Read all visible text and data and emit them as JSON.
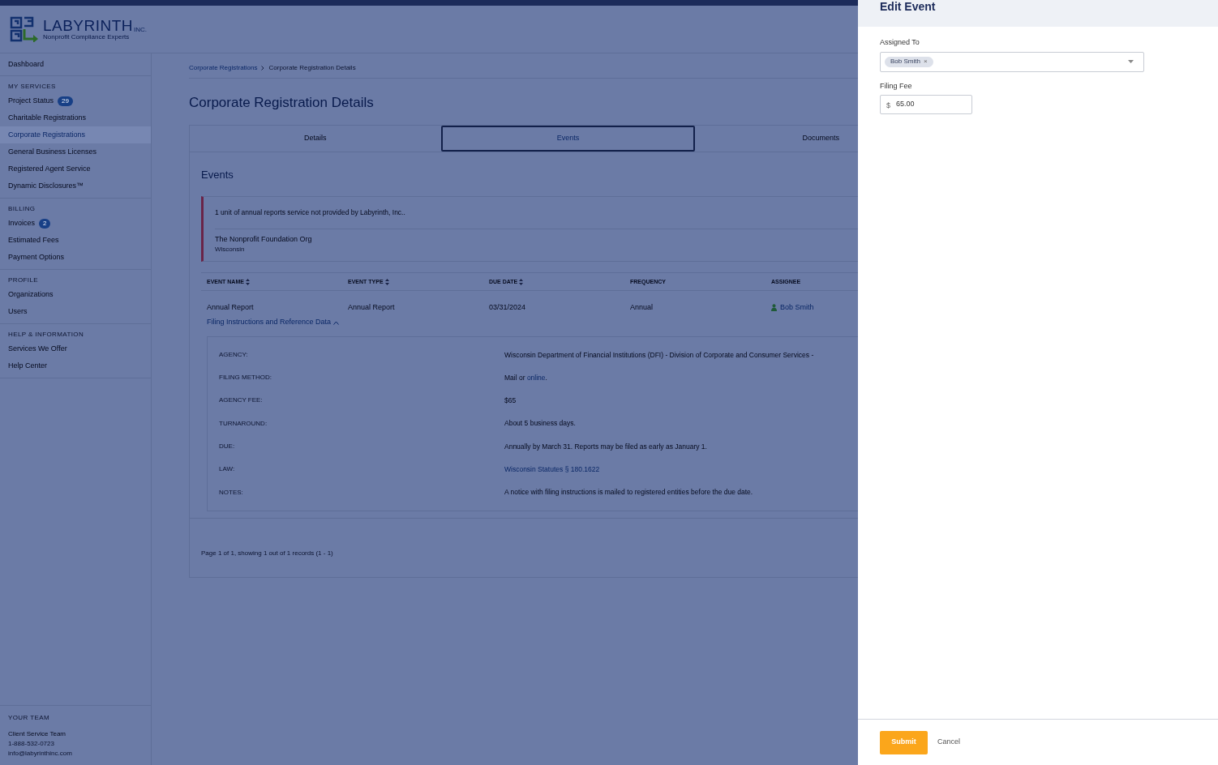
{
  "brand": {
    "name": "LABYRINTH",
    "suffix": "INC.",
    "tagline": "Nonprofit Compliance Experts"
  },
  "sidebar": {
    "top_item": {
      "label": "Dashboard",
      "selected": false
    },
    "sections": [
      {
        "heading": "MY SERVICES",
        "items": [
          {
            "label": "Project Status",
            "badge": "29",
            "selected": false
          },
          {
            "label": "Charitable Registrations",
            "selected": false
          },
          {
            "label": "Corporate Registrations",
            "selected": true
          },
          {
            "label": "General Business Licenses",
            "selected": false
          },
          {
            "label": "Registered Agent Service",
            "selected": false
          },
          {
            "label": "Dynamic Disclosures™",
            "selected": false
          }
        ]
      },
      {
        "heading": "BILLING",
        "items": [
          {
            "label": "Invoices",
            "badge": "2",
            "selected": false
          },
          {
            "label": "Estimated Fees",
            "selected": false
          },
          {
            "label": "Payment Options",
            "selected": false
          }
        ]
      },
      {
        "heading": "PROFILE",
        "items": [
          {
            "label": "Organizations",
            "selected": false
          },
          {
            "label": "Users",
            "selected": false
          }
        ]
      },
      {
        "heading": "HELP & INFORMATION",
        "items": [
          {
            "label": "Services We Offer",
            "selected": false
          },
          {
            "label": "Help Center",
            "selected": false
          }
        ]
      }
    ],
    "team": {
      "heading": "YOUR TEAM",
      "name": "Client Service Team",
      "phone": "1-888-532-0723",
      "email": "info@labyrinthinc.com"
    }
  },
  "breadcrumb": [
    "Corporate Registrations",
    "Corporate Registration Details"
  ],
  "page_title": "Corporate Registration Details",
  "tabs": [
    {
      "label": "Details",
      "selected": false
    },
    {
      "label": "Events",
      "selected": true
    },
    {
      "label": "Documents",
      "selected": false
    }
  ],
  "section_title": "Events",
  "notice": {
    "message": "1 unit of annual reports service not provided by Labyrinth, Inc..",
    "org": "The Nonprofit Foundation Org",
    "state": "Wisconsin"
  },
  "table": {
    "columns": [
      {
        "label": "EVENT NAME",
        "sortable": true
      },
      {
        "label": "EVENT TYPE",
        "sortable": true
      },
      {
        "label": "DUE DATE",
        "sortable": true
      },
      {
        "label": "FREQUENCY",
        "sortable": false
      },
      {
        "label": "ASSIGNEE",
        "sortable": false
      }
    ],
    "rows": [
      {
        "cells": [
          "Annual Report",
          "Annual Report",
          "03/31/2024",
          "Annual"
        ],
        "assignee": "Bob Smith"
      }
    ]
  },
  "details_toggle": {
    "label": "Filing Instructions and Reference Data",
    "expanded": true
  },
  "details": [
    {
      "label": "AGENCY:",
      "value": "Wisconsin Department of Financial Institutions (DFI) - Division of Corporate and Consumer Services -"
    },
    {
      "label": "FILING METHOD:",
      "value": "Mail or ",
      "link": "online",
      "after": "."
    },
    {
      "label": "AGENCY FEE:",
      "value": "$65"
    },
    {
      "label": "TURNAROUND:",
      "value": "About 5 business days."
    },
    {
      "label": "DUE:",
      "value": "Annually by March 31. Reports may be filed as early as January 1."
    },
    {
      "label": "LAW:",
      "link": "Wisconsin Statutes § 180.1622"
    },
    {
      "label": "NOTES:",
      "value": "A notice with filing instructions is mailed to registered entities before the due date."
    }
  ],
  "pagination": "Page 1 of 1, showing 1 out of 1 records (1 - 1)",
  "panel": {
    "title": "Edit Event",
    "assigned_label": "Assigned To",
    "assigned_chip": "Bob Smith",
    "chip_remove": "×",
    "fee_label": "Filing Fee",
    "fee_prefix": "$",
    "fee_value": "65.00",
    "submit": "Submit",
    "cancel": "Cancel"
  }
}
